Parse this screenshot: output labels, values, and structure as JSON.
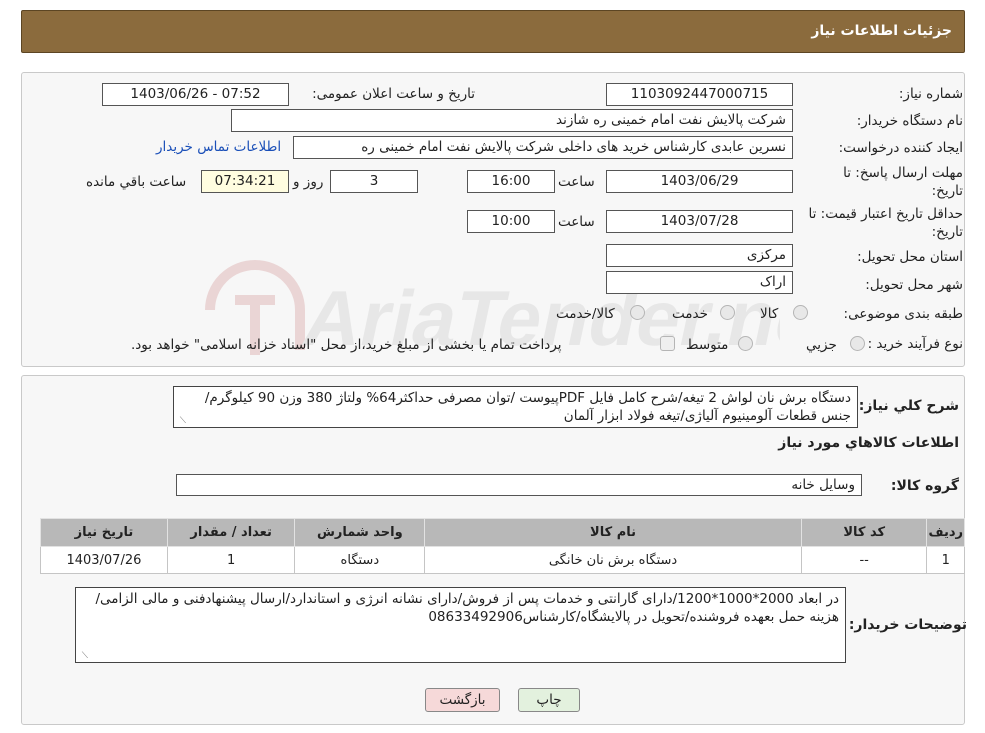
{
  "header": {
    "title": "جزئیات اطلاعات نیاز"
  },
  "form": {
    "need_number": {
      "label": "شماره نیاز:",
      "value": "1103092447000715"
    },
    "announce_datetime": {
      "label": "تاریخ و ساعت اعلان عمومی:",
      "value": "1403/06/26 - 07:52"
    },
    "buyer_org": {
      "label": "نام دستگاه خریدار:",
      "value": "شرکت پالایش نفت امام خمینی  ره  شازند"
    },
    "requester": {
      "label": "ایجاد کننده درخواست:",
      "value": "نسرین عابدی کارشناس خرید های داخلی  شرکت پالایش نفت امام خمینی  ره",
      "contact_link": "اطلاعات تماس خریدار"
    },
    "reply_deadline": {
      "label_line1": "مهلت ارسال پاسخ: تا",
      "label_line2": "تاریخ:",
      "date": "1403/06/29",
      "time_label": "ساعت",
      "time": "16:00",
      "days": "3",
      "days_label": "روز و",
      "remaining": "07:34:21",
      "remaining_label": "ساعت باقي مانده"
    },
    "price_validity": {
      "label_line1": "حداقل تاریخ اعتبار قیمت: تا",
      "label_line2": "تاریخ:",
      "date": "1403/07/28",
      "time_label": "ساعت",
      "time": "10:00"
    },
    "province": {
      "label": "استان محل تحویل:",
      "value": "مرکزی"
    },
    "city": {
      "label": "شهر محل تحویل:",
      "value": "اراک"
    },
    "category": {
      "label": "طبقه بندی موضوعی:",
      "options": [
        "کالا",
        "خدمت",
        "کالا/خدمت"
      ]
    },
    "process": {
      "label": "نوع فرآیند خرید :",
      "options": [
        "جزیي",
        "متوسط"
      ],
      "note": "پرداخت تمام یا بخشی از مبلغ خرید،از محل \"اسناد خزانه اسلامی\" خواهد بود."
    }
  },
  "summary": {
    "label": "شرح کلي نياز:",
    "text": "دستگاه برش نان لواش 2 تیغه/شرح کامل فایل PDFپیوست /توان مصرفی حداکثر64% ولتاژ 380 وزن 90 کیلوگرم/جنس قطعات آلومینیوم آلیاژی/تیغه فولاد ابزار آلمان"
  },
  "goods_section": {
    "title": "اطلاعات کالاهاي مورد نياز",
    "group_label": "گروه کالا:",
    "group_value": "وسایل خانه",
    "table": {
      "headers": [
        "رديف",
        "کد کالا",
        "نام کالا",
        "واحد شمارش",
        "تعداد / مقدار",
        "تاريخ نياز"
      ],
      "rows": [
        [
          "1",
          "--",
          "دستگاه برش نان خانگی",
          "دستگاه",
          "1",
          "1403/07/26"
        ]
      ]
    }
  },
  "buyer_notes": {
    "label": "توضیحات خریدار:",
    "text": "در ابعاد 2000*1000*1200/دارای گارانتی و خدمات پس از فروش/دارای نشانه انرژی و استاندارد/ارسال پیشنهادفنی و مالی الزامی/هزینه حمل بعهده فروشنده/تحویل در پالایشگاه/کارشناس08633492906"
  },
  "buttons": {
    "print": "چاپ",
    "back": "بازگشت"
  },
  "colors": {
    "header_bg": "#8b6b3d",
    "back_button_bg": "#f6d9d9",
    "print_button_bg": "#e3f1de"
  }
}
